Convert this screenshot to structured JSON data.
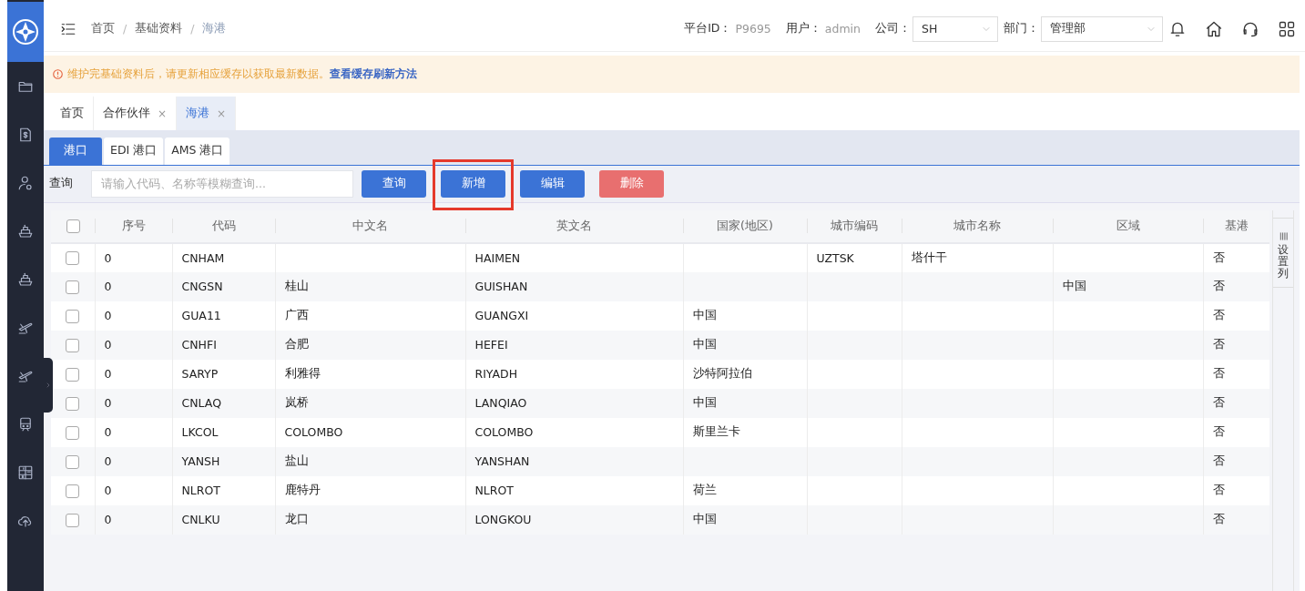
{
  "breadcrumb": [
    {
      "label": "首页",
      "current": false
    },
    {
      "label": "基础资料",
      "current": false
    },
    {
      "label": "海港",
      "current": true
    }
  ],
  "breadcrumb_separator": "/",
  "header": {
    "platform_label": "平台ID：",
    "platform_id": "P9695",
    "user_label": "用户：",
    "user": "admin",
    "company_label": "公司：",
    "company": "SH",
    "department_label": "部门：",
    "department": "管理部"
  },
  "notice": {
    "text": "维护完基础资料后，请更新相应缓存以获取最新数据。",
    "link": "查看缓存刷新方法"
  },
  "page_tabs": [
    {
      "label": "首页",
      "selected": false
    },
    {
      "label": "合作伙伴",
      "close": "×",
      "selected": false
    },
    {
      "label": "海港",
      "close": "×",
      "selected": true
    }
  ],
  "sub_tabs": [
    {
      "label": "港口",
      "selected": true
    },
    {
      "label": "EDI 港口",
      "selected": false
    },
    {
      "label": "AMS 港口",
      "selected": false
    }
  ],
  "toolbar": {
    "label": "查询",
    "search": {
      "placeholder": "请输入代码、名称等模糊查询..."
    },
    "buttons": [
      {
        "label": "查询",
        "kind": "primary"
      },
      {
        "label": "新增",
        "kind": "primary",
        "highlighted": true
      },
      {
        "label": "编辑",
        "kind": "primary"
      },
      {
        "label": "删除",
        "kind": "danger"
      }
    ]
  },
  "table": {
    "select_all_checked": false,
    "columns": [
      "序号",
      "代码",
      "中文名",
      "英文名",
      "国家(地区)",
      "城市编码",
      "城市名称",
      "区域",
      "基港"
    ],
    "rows": [
      {
        "checked": false,
        "cells": [
          "0",
          "CNHAM",
          "",
          "HAIMEN",
          "",
          "UZTSK",
          "塔什干",
          "",
          "否"
        ]
      },
      {
        "checked": false,
        "cells": [
          "0",
          "CNGSN",
          "桂山",
          "GUISHAN",
          "",
          "",
          "",
          "中国",
          "否"
        ]
      },
      {
        "checked": false,
        "cells": [
          "0",
          "GUA11",
          "广西",
          "GUANGXI",
          "中国",
          "",
          "",
          "",
          "否"
        ]
      },
      {
        "checked": false,
        "cells": [
          "0",
          "CNHFI",
          "合肥",
          "HEFEI",
          "中国",
          "",
          "",
          "",
          "否"
        ]
      },
      {
        "checked": false,
        "cells": [
          "0",
          "SARYP",
          "利雅得",
          "RIYADH",
          "沙特阿拉伯",
          "",
          "",
          "",
          "否"
        ]
      },
      {
        "checked": false,
        "cells": [
          "0",
          "CNLAQ",
          "岚桥",
          "LANQIAO",
          "中国",
          "",
          "",
          "",
          "否"
        ]
      },
      {
        "checked": false,
        "cells": [
          "0",
          "LKCOL",
          "COLOMBO",
          "COLOMBO",
          "斯里兰卡",
          "",
          "",
          "",
          "否"
        ]
      },
      {
        "checked": false,
        "cells": [
          "0",
          "YANSH",
          "盐山",
          "YANSHAN",
          "",
          "",
          "",
          "",
          "否"
        ]
      },
      {
        "checked": false,
        "cells": [
          "0",
          "NLROT",
          "鹿特丹",
          "NLROT",
          "荷兰",
          "",
          "",
          "",
          "否"
        ]
      },
      {
        "checked": false,
        "cells": [
          "0",
          "CNLKU",
          "龙口",
          "LONGKOU",
          "中国",
          "",
          "",
          "",
          "否"
        ]
      }
    ]
  },
  "column_settings": {
    "label": "设置列"
  }
}
